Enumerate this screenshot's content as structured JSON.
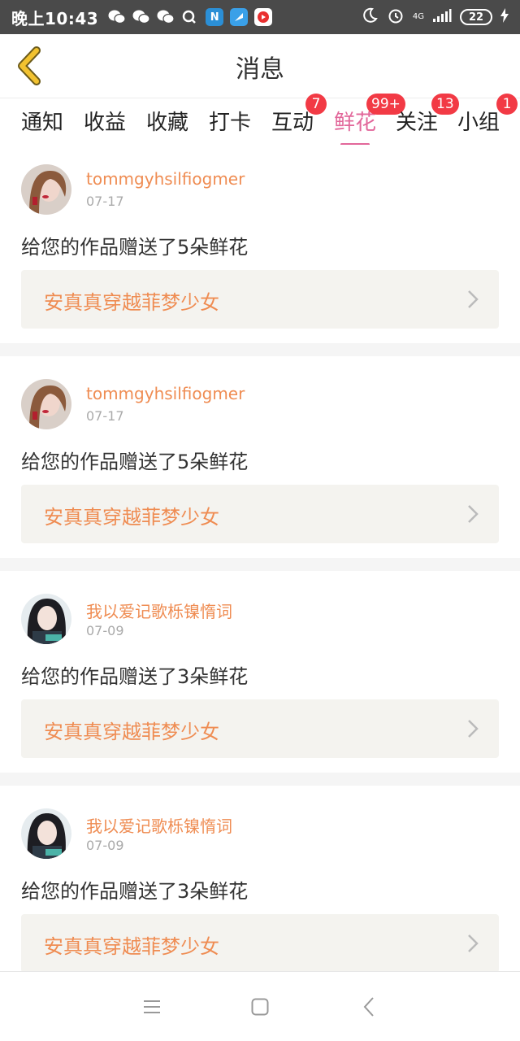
{
  "status_bar": {
    "time": "晚上10:43",
    "apps": [
      "wechat-icon",
      "wechat-icon",
      "wechat-icon",
      "search-icon",
      "n-app-icon",
      "note-app-icon",
      "video-app-icon"
    ],
    "network": "4G",
    "battery": "22"
  },
  "header": {
    "title": "消息"
  },
  "tabs": [
    {
      "label": "通知",
      "badge": ""
    },
    {
      "label": "收益",
      "badge": ""
    },
    {
      "label": "收藏",
      "badge": ""
    },
    {
      "label": "打卡",
      "badge": ""
    },
    {
      "label": "互动",
      "badge": "7"
    },
    {
      "label": "鲜花",
      "badge": "99+"
    },
    {
      "label": "关注",
      "badge": "13"
    },
    {
      "label": "小组",
      "badge": "1"
    }
  ],
  "active_tab": "鲜花",
  "messages": [
    {
      "user": "tommgyhsilfiogmer",
      "date": "07-17",
      "text": "给您的作品赠送了5朵鲜花",
      "work": "安真真穿越菲梦少女"
    },
    {
      "user": "tommgyhsilfiogmer",
      "date": "07-17",
      "text": "给您的作品赠送了5朵鲜花",
      "work": "安真真穿越菲梦少女"
    },
    {
      "user": "我以爱记歌栎镍惰词",
      "date": "07-09",
      "text": "给您的作品赠送了3朵鲜花",
      "work": "安真真穿越菲梦少女"
    },
    {
      "user": "我以爱记歌栎镍惰词",
      "date": "07-09",
      "text": "给您的作品赠送了3朵鲜花",
      "work": "安真真穿越菲梦少女"
    }
  ],
  "colors": {
    "accent_pink": "#e2679a",
    "name_orange": "#ef8c52",
    "badge_red": "#f23a45",
    "back_yellow": "#f2c230"
  }
}
